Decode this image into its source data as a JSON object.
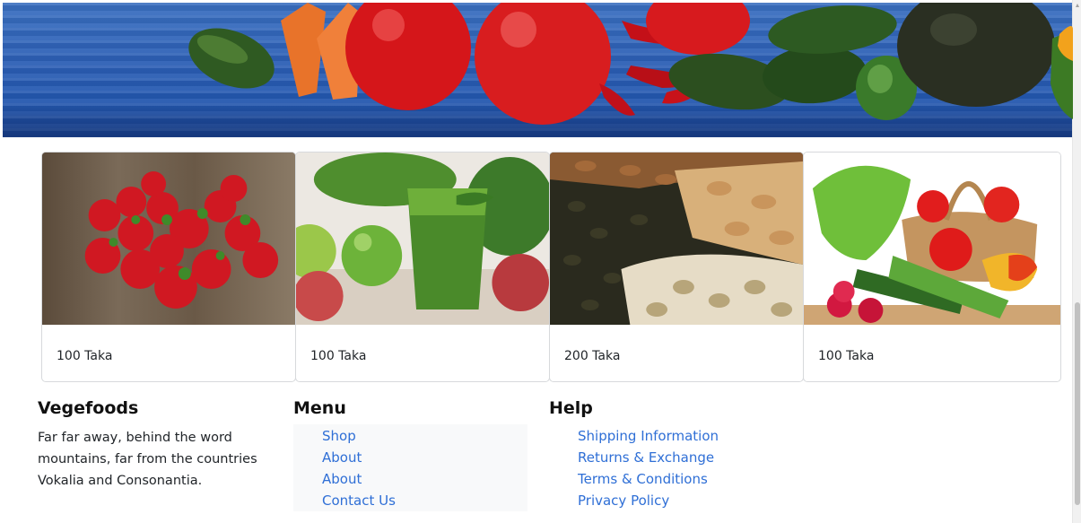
{
  "hero": {
    "icon": "vegetables-banner-image"
  },
  "cards": [
    {
      "image": "strawberries-image",
      "price": "100 Taka"
    },
    {
      "image": "green-smoothie-image",
      "price": "100 Taka"
    },
    {
      "image": "mixed-nuts-image",
      "price": "200 Taka"
    },
    {
      "image": "vegetable-basket-image",
      "price": "100 Taka"
    }
  ],
  "footer": {
    "brand": {
      "title": "Vegefoods",
      "text": "Far far away, behind the word mountains, far from the countries Vokalia and Consonantia."
    },
    "menu": {
      "title": "Menu",
      "items": [
        "Shop",
        "About",
        "About",
        "Contact Us"
      ]
    },
    "help": {
      "title": "Help",
      "items": [
        "Shipping Information",
        "Returns & Exchange",
        "Terms & Conditions",
        "Privacy Policy"
      ]
    }
  },
  "colors": {
    "link": "#2f6fd6",
    "banner_blue": "#2c5fb5",
    "menu_bg": "#f8f9fa"
  }
}
